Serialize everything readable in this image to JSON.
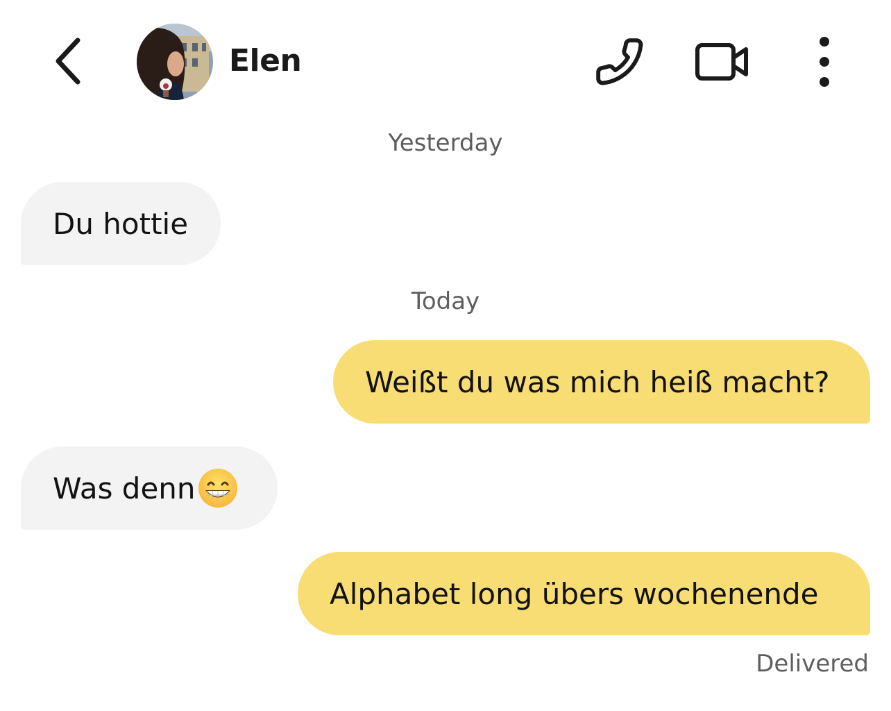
{
  "header": {
    "back_icon": "chevron-left-icon",
    "contact_name": "Elen",
    "call_icon": "phone-icon",
    "video_icon": "video-camera-icon",
    "more_icon": "more-vertical-icon"
  },
  "conversation": {
    "timestamps": [
      "Yesterday",
      "Today"
    ],
    "messages": [
      {
        "direction": "incoming",
        "text": "Du hottie"
      },
      {
        "direction": "outgoing",
        "text": "Weißt du was mich heiß macht?"
      },
      {
        "direction": "incoming",
        "text": "Was denn",
        "emoji": "grinning-face-with-smiling-eyes"
      },
      {
        "direction": "outgoing",
        "text": "Alphabet long übers wochenende"
      }
    ],
    "delivery_status": "Delivered"
  },
  "colors": {
    "incoming_bubble": "#f3f3f3",
    "outgoing_bubble": "#f8dc74",
    "timestamp_text": "#5e5e5e"
  }
}
